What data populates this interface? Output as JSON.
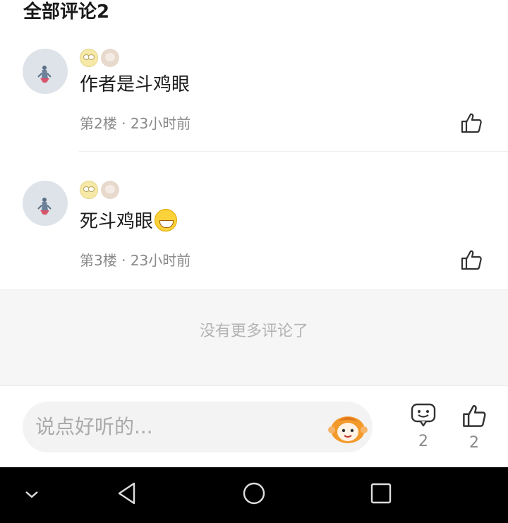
{
  "header": {
    "title": "全部评论2"
  },
  "comments": [
    {
      "text": "作者是斗鸡眼",
      "floor": "第2楼",
      "time": "23小时前",
      "badges": [
        "rolling-eyes-emoji",
        "monkey-icon"
      ]
    },
    {
      "text": "死斗鸡眼",
      "floor": "第3楼",
      "time": "23小时前",
      "badges": [
        "rolling-eyes-emoji",
        "monkey-icon"
      ],
      "trailing_emoji": "grinning-face-emoji"
    }
  ],
  "separator": "·",
  "footer": {
    "no_more": "没有更多评论了"
  },
  "bottom_bar": {
    "placeholder": "说点好听的...",
    "comment_count": "2",
    "like_count": "2"
  },
  "navbar": {
    "items": [
      "chevron-down-icon",
      "back-icon",
      "home-icon",
      "recents-icon"
    ]
  },
  "colors": {
    "text": "#1c1c1c",
    "meta": "#888888",
    "accent": "#f39a2b"
  }
}
